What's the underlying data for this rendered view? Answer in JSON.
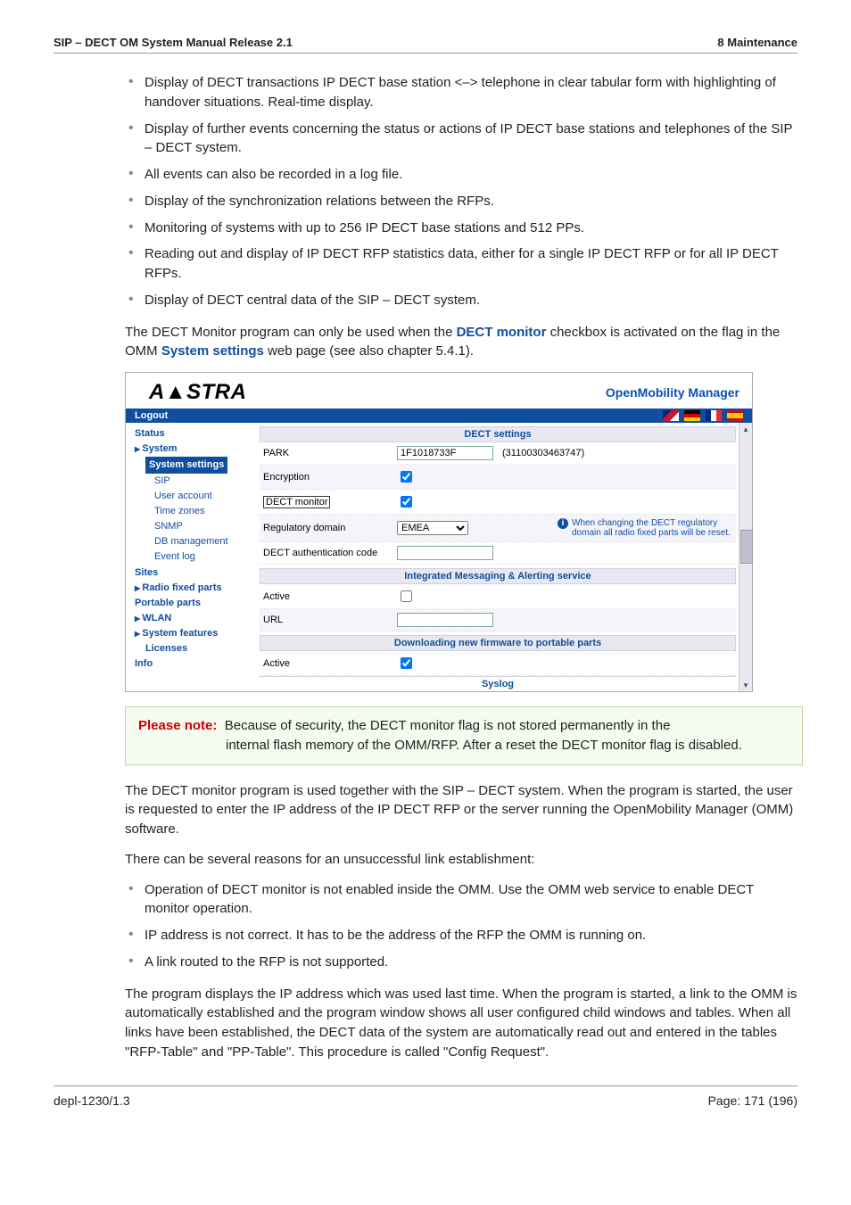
{
  "header": {
    "left": "SIP – DECT OM System Manual Release 2.1",
    "right": "8 Maintenance"
  },
  "bullets_top": [
    "Display of DECT transactions IP DECT base station <–> telephone in clear tabular form with highlighting of handover situations. Real-time display.",
    "Display of further events concerning the status or actions of IP DECT base stations and telephones of the SIP – DECT system.",
    "All events can also be recorded in a log file.",
    "Display of the synchronization relations between the RFPs.",
    "Monitoring of systems with up to 256 IP DECT base stations and 512 PPs.",
    "Reading out and display of IP DECT RFP statistics data, either for a single IP DECT RFP or for all IP DECT RFPs.",
    "Display of DECT central data of the SIP – DECT system."
  ],
  "para_intro": {
    "pre": "The DECT Monitor program can only be used when the ",
    "link1": "DECT monitor",
    "mid": " checkbox is activated on the flag in the OMM ",
    "link2": "System settings",
    "post": " web page (see also chapter 5.4.1)."
  },
  "shot": {
    "brand": "A▲STRA",
    "title": "OpenMobility Manager",
    "logout": "Logout",
    "sidebar": {
      "status": "Status",
      "system": "System",
      "system_settings": "System settings",
      "sip": "SIP",
      "user_account": "User account",
      "time_zones": "Time zones",
      "snmp": "SNMP",
      "db_mgmt": "DB management",
      "event_log": "Event log",
      "sites": "Sites",
      "radio_fixed": "Radio fixed parts",
      "portable": "Portable parts",
      "wlan": "WLAN",
      "features": "System features",
      "licenses": "Licenses",
      "info": "Info"
    },
    "section_dect": "DECT settings",
    "row_park_lbl": "PARK",
    "row_park_val": "1F1018733F",
    "row_park_aux": "(31100303463747)",
    "row_enc_lbl": "Encryption",
    "row_dectmon_lbl": "DECT monitor",
    "row_regdom_lbl": "Regulatory domain",
    "row_regdom_val": "EMEA",
    "row_regdom_hint": "When changing the DECT regulatory domain all radio fixed parts will be reset.",
    "row_auth_lbl": "DECT authentication code",
    "section_msg": "Integrated Messaging & Alerting service",
    "row_active_lbl": "Active",
    "row_url_lbl": "URL",
    "section_dl": "Downloading new firmware to portable parts",
    "row_active2_lbl": "Active",
    "syslog": "Syslog"
  },
  "note": {
    "label": "Please note:",
    "line1": "Because of security, the DECT monitor flag is not stored permanently in the",
    "line2": "internal flash memory of the OMM/RFP. After a reset the DECT monitor flag is disabled."
  },
  "para_usage": "The DECT monitor program is used together with the SIP – DECT system. When the program is started, the user is requested to enter the IP address of the IP DECT RFP or the server running the OpenMobility Manager (OMM) software.",
  "para_reasons": "There can be several reasons for an unsuccessful link establishment:",
  "bullets_reasons": [
    "Operation of DECT monitor is not enabled inside the OMM. Use the OMM web service to enable DECT monitor operation.",
    "IP address is not correct. It has to be the address of the RFP the OMM is running on.",
    "A link routed to the RFP is not supported."
  ],
  "para_last": "The program displays the IP address which was used last time. When the program is started, a link to the OMM is automatically established and the program window shows all user configured child windows and tables. When all links have been established, the DECT data of the system are automatically read out and entered in the tables \"RFP-Table\" and \"PP-Table\". This procedure is called \"Config Request\".",
  "footer": {
    "left": "depl-1230/1.3",
    "right": "Page: 171 (196)"
  }
}
